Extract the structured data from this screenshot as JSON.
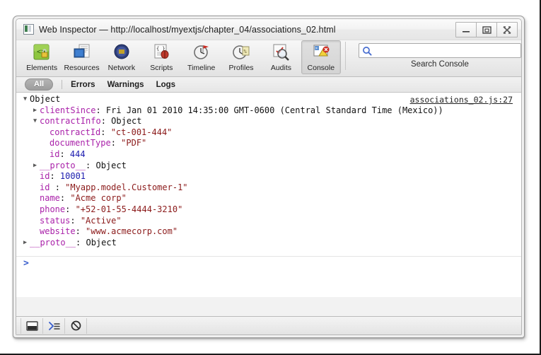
{
  "window": {
    "title": "Web Inspector — http://localhost/myextjs/chapter_04/associations_02.html",
    "app_icon": "web-inspector-icon",
    "controls": [
      {
        "name": "minimize-button",
        "glyph": "minimize-icon"
      },
      {
        "name": "restore-button",
        "glyph": "restore-icon"
      },
      {
        "name": "close-button",
        "glyph": "close-icon"
      }
    ]
  },
  "toolbar": {
    "panels": [
      {
        "id": "elements",
        "label": "Elements",
        "icon": "elements-icon",
        "selected": false
      },
      {
        "id": "resources",
        "label": "Resources",
        "icon": "resources-icon",
        "selected": false
      },
      {
        "id": "network",
        "label": "Network",
        "icon": "network-icon",
        "selected": false
      },
      {
        "id": "scripts",
        "label": "Scripts",
        "icon": "scripts-icon",
        "selected": false
      },
      {
        "id": "timeline",
        "label": "Timeline",
        "icon": "timeline-icon",
        "selected": false
      },
      {
        "id": "profiles",
        "label": "Profiles",
        "icon": "profiles-icon",
        "selected": false
      },
      {
        "id": "audits",
        "label": "Audits",
        "icon": "audits-icon",
        "selected": false
      },
      {
        "id": "console",
        "label": "Console",
        "icon": "console-icon",
        "selected": true
      }
    ],
    "search": {
      "icon": "search-icon",
      "value": "",
      "placeholder": "",
      "caption": "Search Console"
    }
  },
  "filterbar": {
    "all_label": "All",
    "items": [
      {
        "id": "errors",
        "label": "Errors"
      },
      {
        "id": "warnings",
        "label": "Warnings"
      },
      {
        "id": "logs",
        "label": "Logs"
      }
    ]
  },
  "console": {
    "source_link": "associations_02.js:27",
    "prompt": ">",
    "rows": [
      {
        "indent": 0,
        "marker": "open",
        "parts": [
          {
            "cls": "d",
            "text": "Object"
          }
        ]
      },
      {
        "indent": 1,
        "marker": "closed",
        "parts": [
          {
            "cls": "k",
            "text": "clientSince"
          },
          {
            "cls": "d",
            "text": ": Fri Jan 01 2010 14:35:00 GMT-0600 (Central Standard Time (Mexico))"
          }
        ]
      },
      {
        "indent": 1,
        "marker": "open",
        "parts": [
          {
            "cls": "k",
            "text": "contractInfo"
          },
          {
            "cls": "d",
            "text": ": Object"
          }
        ]
      },
      {
        "indent": 2,
        "marker": "none",
        "parts": [
          {
            "cls": "k",
            "text": "contractId"
          },
          {
            "cls": "d",
            "text": ": "
          },
          {
            "cls": "s",
            "text": "\"ct-001-444\""
          }
        ]
      },
      {
        "indent": 2,
        "marker": "none",
        "parts": [
          {
            "cls": "k",
            "text": "documentType"
          },
          {
            "cls": "d",
            "text": ": "
          },
          {
            "cls": "s",
            "text": "\"PDF\""
          }
        ]
      },
      {
        "indent": 2,
        "marker": "none",
        "parts": [
          {
            "cls": "k",
            "text": "id"
          },
          {
            "cls": "d",
            "text": ": "
          },
          {
            "cls": "n",
            "text": "444"
          }
        ]
      },
      {
        "indent": 1,
        "marker": "closed",
        "parts": [
          {
            "cls": "proto",
            "text": "__proto__"
          },
          {
            "cls": "d",
            "text": ": Object"
          }
        ]
      },
      {
        "indent": 1,
        "marker": "none",
        "parts": [
          {
            "cls": "k",
            "text": "id"
          },
          {
            "cls": "d",
            "text": ": "
          },
          {
            "cls": "n",
            "text": "10001"
          }
        ]
      },
      {
        "indent": 1,
        "marker": "none",
        "parts": [
          {
            "cls": "k",
            "text": "id "
          },
          {
            "cls": "d",
            "text": ": "
          },
          {
            "cls": "s",
            "text": "\"Myapp.model.Customer-1\""
          }
        ]
      },
      {
        "indent": 1,
        "marker": "none",
        "parts": [
          {
            "cls": "k",
            "text": "name"
          },
          {
            "cls": "d",
            "text": ": "
          },
          {
            "cls": "s",
            "text": "\"Acme corp\""
          }
        ]
      },
      {
        "indent": 1,
        "marker": "none",
        "parts": [
          {
            "cls": "k",
            "text": "phone"
          },
          {
            "cls": "d",
            "text": ": "
          },
          {
            "cls": "s",
            "text": "\"+52-01-55-4444-3210\""
          }
        ]
      },
      {
        "indent": 1,
        "marker": "none",
        "parts": [
          {
            "cls": "k",
            "text": "status"
          },
          {
            "cls": "d",
            "text": ": "
          },
          {
            "cls": "s",
            "text": "\"Active\""
          }
        ]
      },
      {
        "indent": 1,
        "marker": "none",
        "parts": [
          {
            "cls": "k",
            "text": "website"
          },
          {
            "cls": "d",
            "text": ": "
          },
          {
            "cls": "s",
            "text": "\"www.acmecorp.com\""
          }
        ]
      },
      {
        "indent": 0,
        "marker": "closed",
        "parts": [
          {
            "cls": "proto",
            "text": "__proto__"
          },
          {
            "cls": "d",
            "text": ": Object"
          }
        ]
      }
    ]
  },
  "bottombar": {
    "buttons": [
      {
        "id": "dock",
        "icon": "dock-window-icon"
      },
      {
        "id": "console-toggle",
        "icon": "console-prompt-icon"
      },
      {
        "id": "clear-console",
        "icon": "clear-console-icon"
      }
    ]
  },
  "colors": {
    "key": "#aa22aa",
    "string": "#8b1a1a",
    "number": "#1a1aae",
    "prompt": "#3a5fcd"
  }
}
